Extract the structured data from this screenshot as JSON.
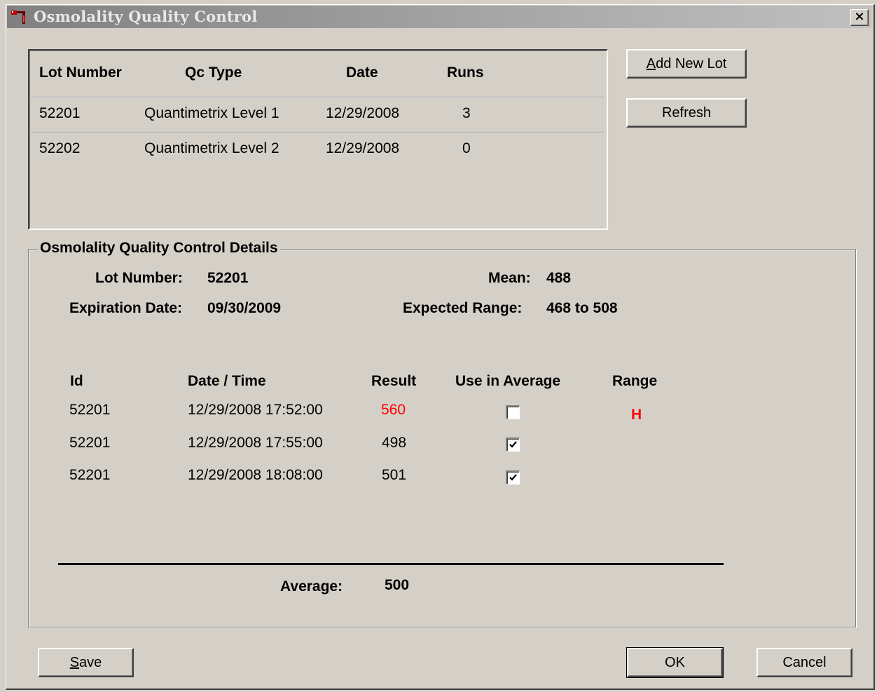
{
  "window": {
    "title": "Osmolality Quality Control",
    "close_glyph": "×"
  },
  "lots": {
    "headers": [
      "Lot Number",
      "Qc Type",
      "Date",
      "Runs"
    ],
    "rows": [
      {
        "lot": "52201",
        "qc_type": "Quantimetrix Level 1",
        "date": "12/29/2008",
        "runs": "3"
      },
      {
        "lot": "52202",
        "qc_type": "Quantimetrix Level 2",
        "date": "12/29/2008",
        "runs": "0"
      }
    ]
  },
  "buttons": {
    "add_new_lot_prefix": "A",
    "add_new_lot_rest": "dd New Lot",
    "refresh": "Refresh",
    "save_prefix": "S",
    "save_rest": "ave",
    "ok": "OK",
    "cancel": "Cancel"
  },
  "details": {
    "group_title": "Osmolality Quality Control Details",
    "lot_number_label": "Lot Number:",
    "lot_number": "52201",
    "expiration_label": "Expiration Date:",
    "expiration": "09/30/2009",
    "mean_label": "Mean:",
    "mean": "488",
    "range_label": "Expected Range:",
    "range": "468 to 508",
    "columns": [
      "Id",
      "Date / Time",
      "Result",
      "Use in Average",
      "Range"
    ],
    "runs": [
      {
        "id": "52201",
        "datetime": "12/29/2008 17:52:00",
        "result": "560",
        "use_in_average": false,
        "range_flag": "H"
      },
      {
        "id": "52201",
        "datetime": "12/29/2008 17:55:00",
        "result": "498",
        "use_in_average": true,
        "range_flag": ""
      },
      {
        "id": "52201",
        "datetime": "12/29/2008 18:08:00",
        "result": "501",
        "use_in_average": true,
        "range_flag": ""
      }
    ],
    "average_label": "Average:",
    "average": "500"
  },
  "colors": {
    "out_of_range": "#ff0000",
    "dialog_bg": "#d4d0c8"
  },
  "icons": {
    "app_icon": "instrument-icon",
    "check_icon": "checkmark-icon"
  }
}
